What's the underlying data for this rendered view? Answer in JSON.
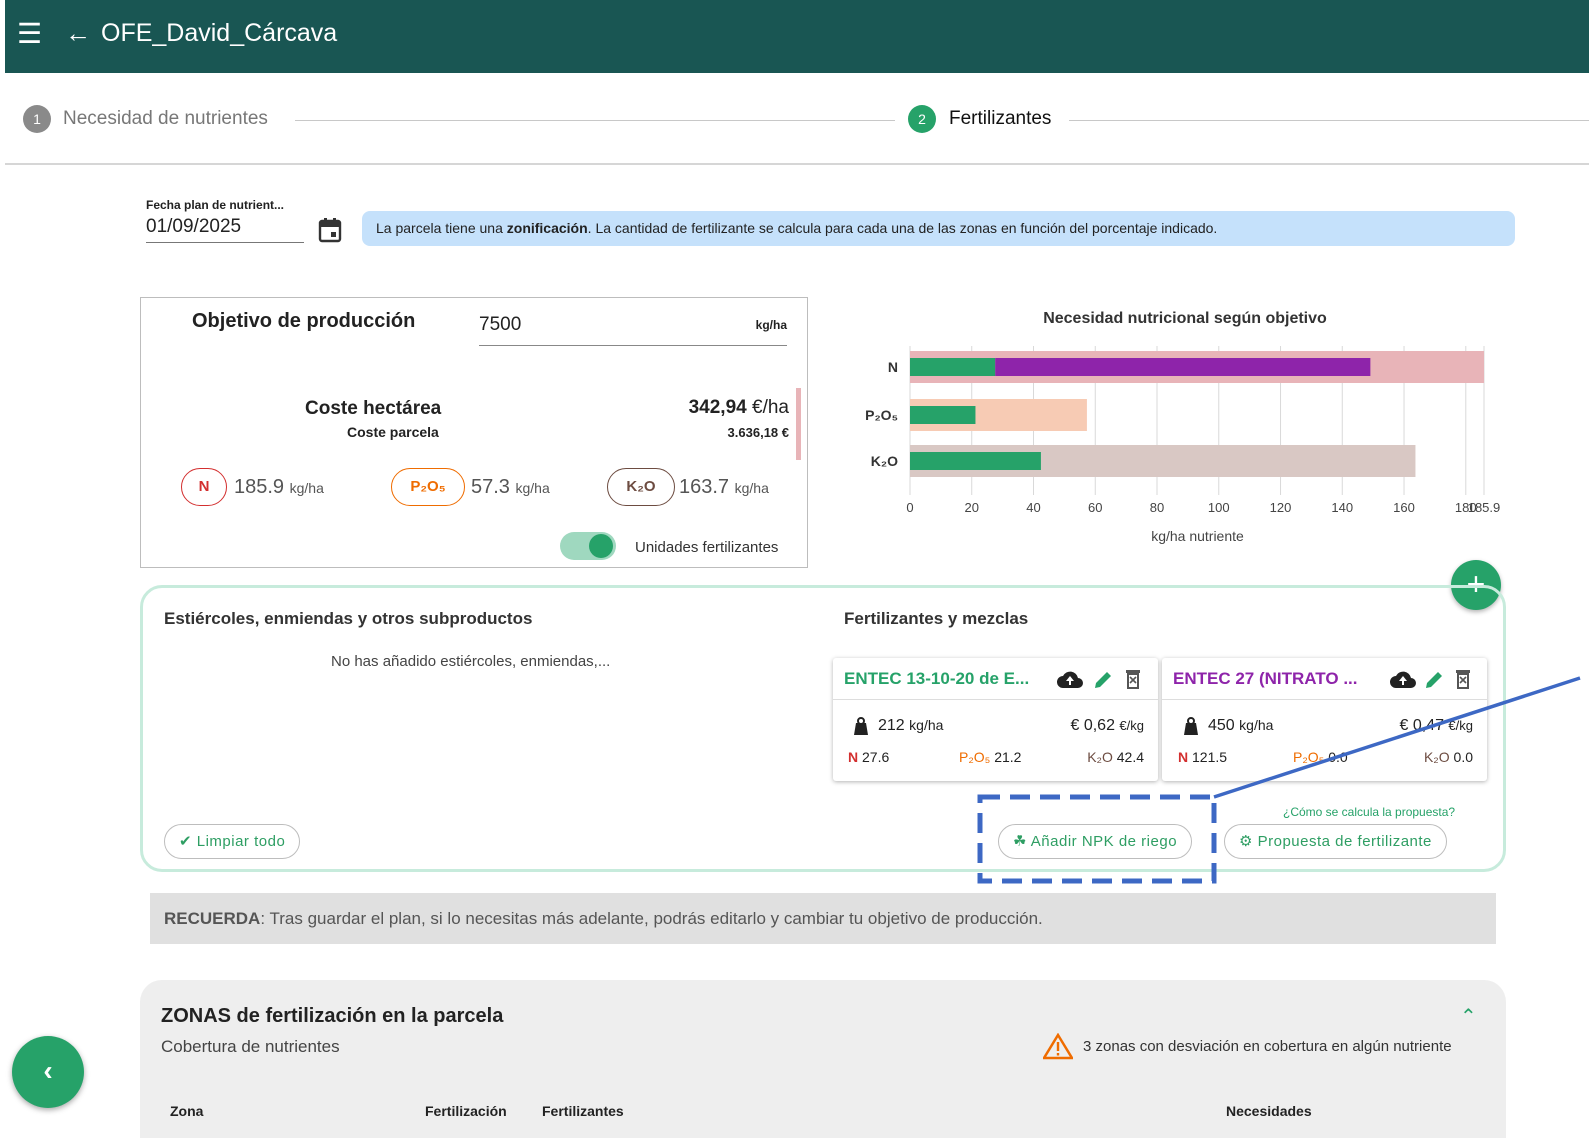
{
  "appbar": {
    "title": "OFE_David_Cárcava"
  },
  "stepper": {
    "steps": [
      {
        "number": "1",
        "label": "Necesidad de nutrientes"
      },
      {
        "number": "2",
        "label": "Fertilizantes"
      }
    ]
  },
  "plan_date": {
    "label": "Fecha plan de nutrient...",
    "value": "01/09/2025"
  },
  "info_banner": {
    "prefix": "La parcela tiene una ",
    "bold": "zonificación",
    "suffix": ". La cantidad de fertilizante se calcula para cada una de las zonas en función del porcentaje indicado."
  },
  "production": {
    "label": "Objetivo de producción",
    "value": "7500",
    "unit": "kg/ha",
    "cost_ha_label": "Coste hectárea",
    "cost_ha_value": "342,94",
    "cost_ha_unit": "€/ha",
    "cost_plot_label": "Coste parcela",
    "cost_plot_value": "3.636,18 €",
    "nutrients": [
      {
        "symbol": "N",
        "value": "185.9",
        "unit": "kg/ha",
        "color": "#d32f2f"
      },
      {
        "symbol": "P₂O₅",
        "value": "57.3",
        "unit": "kg/ha",
        "color": "#ef6c00"
      },
      {
        "symbol": "K₂O",
        "value": "163.7",
        "unit": "kg/ha",
        "color": "#6d4c41"
      }
    ],
    "toggle_label": "Unidades fertilizantes",
    "toggle_on": true
  },
  "chart_data": {
    "type": "bar",
    "orientation": "horizontal",
    "title": "Necesidad nutricional según objetivo",
    "xlabel": "kg/ha nutriente",
    "xlim": [
      0,
      185.9
    ],
    "xticks": [
      "0",
      "20",
      "40",
      "60",
      "80",
      "100",
      "120",
      "140",
      "160",
      "180",
      "185.9"
    ],
    "categories": [
      "N",
      "P₂O₅",
      "K₂O"
    ],
    "series": [
      {
        "role": "requirement",
        "values": [
          185.9,
          57.3,
          163.7
        ],
        "colors": [
          "#e8b4b8",
          "#f7cbb4",
          "#d9c8c4"
        ]
      },
      {
        "role": "ENTEC 13-10-20",
        "values": [
          27.6,
          21.2,
          42.4
        ],
        "color": "#26a269"
      },
      {
        "role": "ENTEC 27",
        "values": [
          121.5,
          0.0,
          0.0
        ],
        "color": "#8e24aa"
      }
    ],
    "grid": true
  },
  "manures": {
    "title": "Estiércoles, enmiendas y otros subproductos",
    "empty_text": "No has añadido estiércoles, enmiendas,..."
  },
  "fertilizers": {
    "title": "Fertilizantes y mezclas",
    "items": [
      {
        "name": "ENTEC 13-10-20 de E...",
        "name_color": "#26a269",
        "dose": "212",
        "dose_unit": "kg/ha",
        "price": "0,62",
        "price_unit": "€/kg",
        "n": "27.6",
        "p": "21.2",
        "k": "42.4"
      },
      {
        "name": "ENTEC 27 (NITRATO ...",
        "name_color": "#8e24aa",
        "dose": "450",
        "dose_unit": "kg/ha",
        "price": "0,47",
        "price_unit": "€/kg",
        "n": "121.5",
        "p": "0.0",
        "k": "0.0"
      }
    ],
    "labels": {
      "n": "N",
      "p": "P₂O₅",
      "k": "K₂O"
    }
  },
  "actions": {
    "clear_all": "Limpiar todo",
    "add_npk": "Añadir NPK de riego",
    "proposal": "Propuesta de fertilizante",
    "how_link": "¿Cómo se calcula la propuesta?"
  },
  "reminder": {
    "bold": "RECUERDA",
    "text": ": Tras guardar el plan, si lo necesitas más adelante, podrás editarlo y cambiar tu objetivo de producción."
  },
  "zones": {
    "title": "ZONAS de fertilización en la parcela",
    "subtitle": "Cobertura de nutrientes",
    "warning": "3 zonas con desviación en cobertura en algún nutriente",
    "columns": [
      "Zona",
      "Fertilización",
      "Fertilizantes",
      "Necesidades"
    ]
  },
  "colors": {
    "appbar": "#195653",
    "accent": "#26a269",
    "annotation": "#3d68c4"
  }
}
